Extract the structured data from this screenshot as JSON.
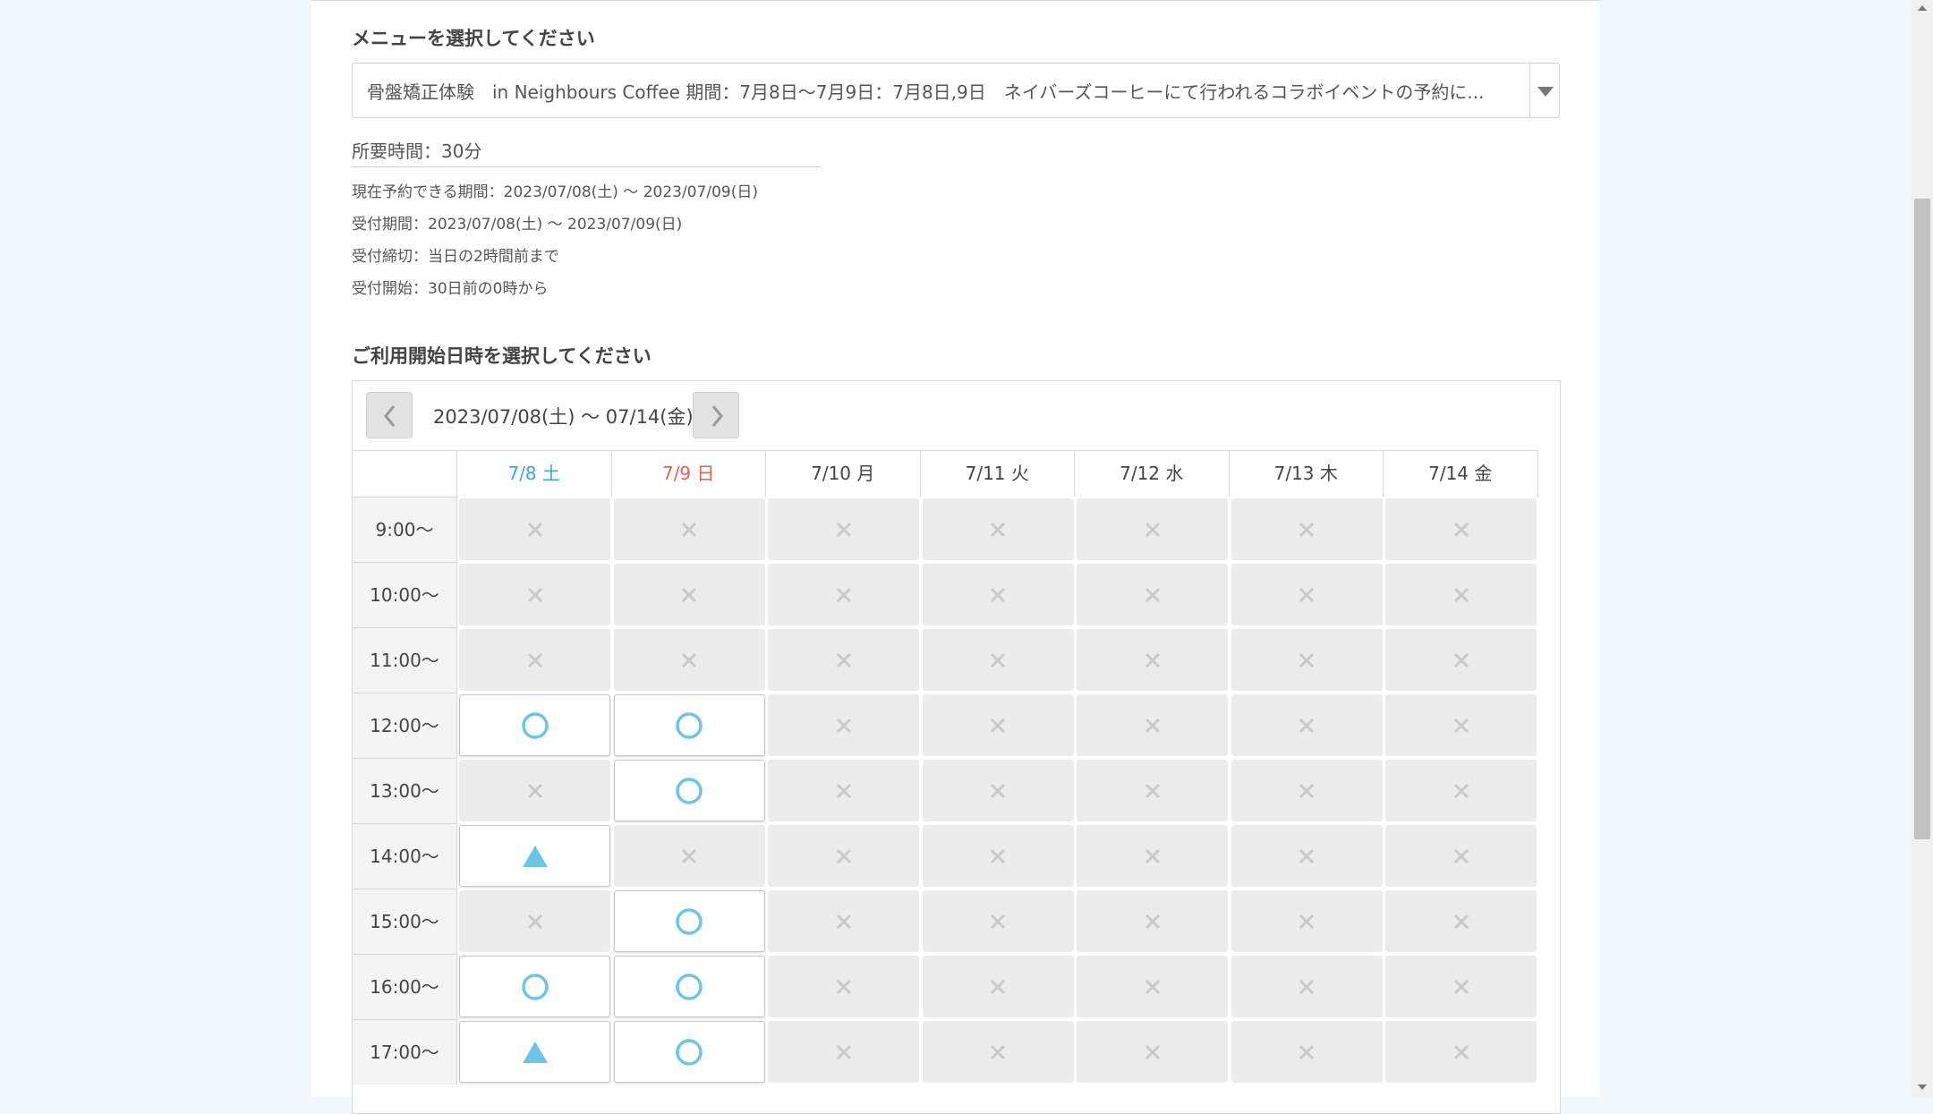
{
  "menu_section": {
    "heading": "メニューを選択してください",
    "selected_menu": "骨盤矯正体験　in Neighbours Coffee 期間：7月8日〜7月9日：7月8日,9日　ネイバーズコーヒーにて行われるコラボイベントの予約に..."
  },
  "details": {
    "duration": "所要時間：30分",
    "booking_period": "現在予約できる期間：2023/07/08(土) 〜 2023/07/09(日)",
    "reception_period": "受付期間：2023/07/08(土) 〜 2023/07/09(日)",
    "deadline": "受付締切：当日の2時間前まで",
    "start": "受付開始：30日前の0時から"
  },
  "calendar_section": {
    "heading": "ご利用開始日時を選択してください",
    "range_label": "2023/07/08(土) 〜 07/14(金)",
    "days": [
      {
        "label": "7/8 土",
        "color": "#3aa8d8"
      },
      {
        "label": "7/9 日",
        "color": "#e8604c"
      },
      {
        "label": "7/10 月",
        "color": "#444444"
      },
      {
        "label": "7/11 火",
        "color": "#444444"
      },
      {
        "label": "7/12 水",
        "color": "#444444"
      },
      {
        "label": "7/13 木",
        "color": "#444444"
      },
      {
        "label": "7/14 金",
        "color": "#444444"
      }
    ],
    "times": [
      "9:00〜",
      "10:00〜",
      "11:00〜",
      "12:00〜",
      "13:00〜",
      "14:00〜",
      "15:00〜",
      "16:00〜",
      "17:00〜"
    ],
    "availability": [
      [
        "x",
        "x",
        "x",
        "x",
        "x",
        "x",
        "x"
      ],
      [
        "x",
        "x",
        "x",
        "x",
        "x",
        "x",
        "x"
      ],
      [
        "x",
        "x",
        "x",
        "x",
        "x",
        "x",
        "x"
      ],
      [
        "circle",
        "circle",
        "x",
        "x",
        "x",
        "x",
        "x"
      ],
      [
        "x",
        "circle",
        "x",
        "x",
        "x",
        "x",
        "x"
      ],
      [
        "triangle",
        "x",
        "x",
        "x",
        "x",
        "x",
        "x"
      ],
      [
        "x",
        "circle",
        "x",
        "x",
        "x",
        "x",
        "x"
      ],
      [
        "circle",
        "circle",
        "x",
        "x",
        "x",
        "x",
        "x"
      ],
      [
        "triangle",
        "circle",
        "x",
        "x",
        "x",
        "x",
        "x"
      ]
    ]
  },
  "colors": {
    "available": "#6cc5e6",
    "unavailable_mark": "#c9c9c9",
    "page_background": "#f0f8fd"
  },
  "icons": {
    "prev": "chevron-left-icon",
    "next": "chevron-right-icon",
    "dropdown": "caret-down-icon",
    "available": "circle-icon",
    "few_left": "triangle-icon",
    "full": "cross-icon"
  }
}
